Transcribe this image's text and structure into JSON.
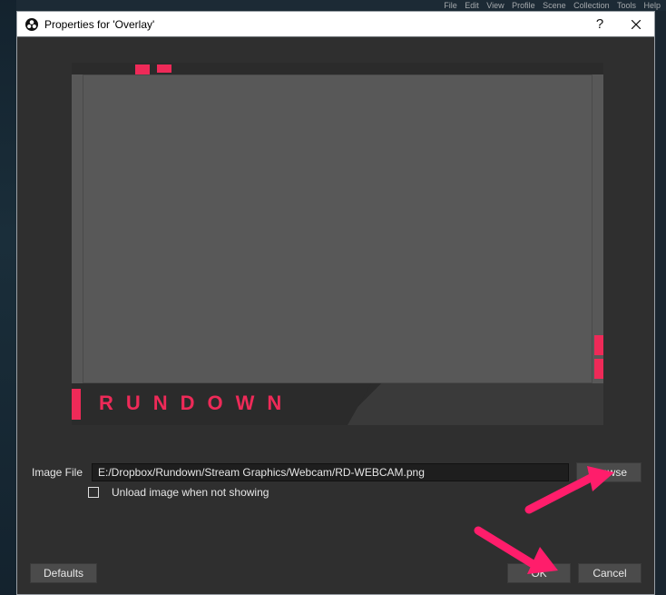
{
  "bg_menu": "File  Edit  View  Profile  Scene Collection  Tools  Help",
  "titlebar": {
    "title": "Properties for 'Overlay'"
  },
  "preview": {
    "brand_text": "RUNDOWN",
    "accent_color": "#ee2a58"
  },
  "form": {
    "image_file_label": "Image File",
    "image_file_value": "E:/Dropbox/Rundown/Stream Graphics/Webcam/RD-WEBCAM.png",
    "browse_label": "Browse",
    "unload_label": "Unload image when not showing",
    "unload_checked": false
  },
  "footer": {
    "defaults_label": "Defaults",
    "ok_label": "OK",
    "cancel_label": "Cancel"
  },
  "annotation_color": "#ff1d6b"
}
